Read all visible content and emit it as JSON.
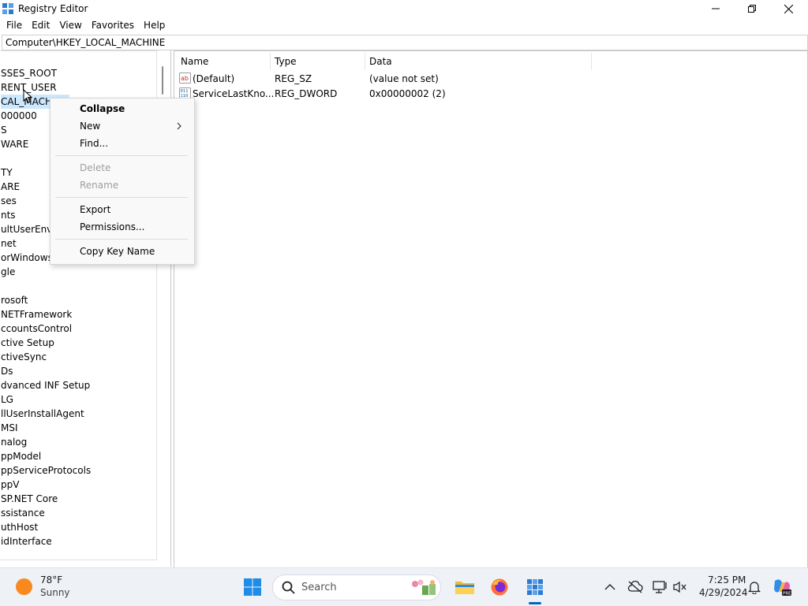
{
  "window": {
    "title": "Registry Editor",
    "address": "Computer\\HKEY_LOCAL_MACHINE"
  },
  "menu": [
    "File",
    "Edit",
    "View",
    "Favorites",
    "Help"
  ],
  "tree": {
    "items": [
      {
        "label": "SSES_ROOT",
        "selected": false
      },
      {
        "label": "RENT_USER",
        "selected": false
      },
      {
        "label": "CAL_MACHI",
        "selected": true
      },
      {
        "label": "000000",
        "selected": false
      },
      {
        "label": "S",
        "selected": false
      },
      {
        "label": "WARE",
        "selected": false
      },
      {
        "label": "",
        "selected": false
      },
      {
        "label": "TY",
        "selected": false
      },
      {
        "label": "ARE",
        "selected": false
      },
      {
        "label": "ses",
        "selected": false
      },
      {
        "label": "nts",
        "selected": false
      },
      {
        "label": "ultUserEnvi",
        "selected": false
      },
      {
        "label": "net",
        "selected": false
      },
      {
        "label": "orWindows",
        "selected": false
      },
      {
        "label": "gle",
        "selected": false
      },
      {
        "label": "",
        "selected": false
      },
      {
        "label": "rosoft",
        "selected": false
      },
      {
        "label": "NETFramework",
        "selected": false
      },
      {
        "label": "ccountsControl",
        "selected": false
      },
      {
        "label": "ctive Setup",
        "selected": false
      },
      {
        "label": "ctiveSync",
        "selected": false
      },
      {
        "label": "Ds",
        "selected": false
      },
      {
        "label": "dvanced INF Setup",
        "selected": false
      },
      {
        "label": "LG",
        "selected": false
      },
      {
        "label": "llUserInstallAgent",
        "selected": false
      },
      {
        "label": "MSI",
        "selected": false
      },
      {
        "label": "nalog",
        "selected": false
      },
      {
        "label": "ppModel",
        "selected": false
      },
      {
        "label": "ppServiceProtocols",
        "selected": false
      },
      {
        "label": "ppV",
        "selected": false
      },
      {
        "label": "SP.NET Core",
        "selected": false
      },
      {
        "label": "ssistance",
        "selected": false
      },
      {
        "label": "uthHost",
        "selected": false
      },
      {
        "label": "idInterface",
        "selected": false
      }
    ]
  },
  "list": {
    "columns": [
      "Name",
      "Type",
      "Data"
    ],
    "rows": [
      {
        "icon": "string-value-icon",
        "name": "(Default)",
        "type": "REG_SZ",
        "data": "(value not set)"
      },
      {
        "icon": "binary-value-icon",
        "name": "ServiceLastKno...",
        "type": "REG_DWORD",
        "data": "0x00000002 (2)"
      }
    ]
  },
  "context_menu": {
    "collapse": "Collapse",
    "new": "New",
    "find": "Find...",
    "delete": "Delete",
    "rename": "Rename",
    "export": "Export",
    "permissions": "Permissions...",
    "copy_key_name": "Copy Key Name"
  },
  "taskbar": {
    "weather_temp": "78°F",
    "weather_condition": "Sunny",
    "search_placeholder": "Search",
    "time": "7:25 PM",
    "date": "4/29/2024"
  },
  "colors": {
    "selection": "#cce8ff",
    "accent": "#0067c0",
    "disabled_text": "#9e9e9e"
  }
}
